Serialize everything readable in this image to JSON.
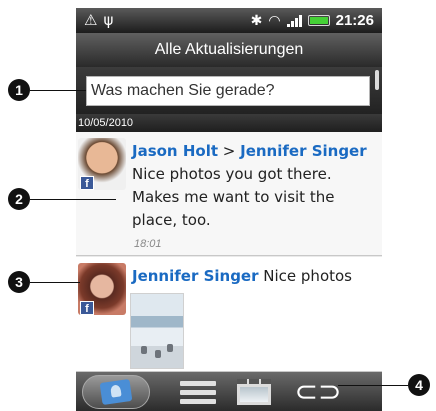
{
  "statusbar": {
    "warning_icon": "warning-icon",
    "usb_icon": "usb-icon",
    "bluetooth_icon": "bluetooth-icon",
    "wifi_icon": "wifi-icon",
    "time": "21:26"
  },
  "title": "Alle Aktualisierungen",
  "input": {
    "placeholder": "Was machen Sie gerade?"
  },
  "date": "10/05/2010",
  "feed": {
    "items": [
      {
        "author": "Jason Holt",
        "separator": " > ",
        "recipient": "Jennifer Singer",
        "message": " Nice photos you got there. Makes me want to visit the place, too.",
        "time": "18:01",
        "network": "f"
      },
      {
        "author": "Jennifer Singer",
        "message": " Nice photos",
        "network": "f"
      }
    ]
  },
  "tabs": [
    {
      "icon": "people-icon",
      "active": true
    },
    {
      "icon": "updates-list-icon",
      "active": false
    },
    {
      "icon": "photos-icon",
      "active": false
    },
    {
      "icon": "link-icon",
      "label": "⊂⊃",
      "active": false
    }
  ],
  "callouts": [
    "1",
    "2",
    "3",
    "4"
  ],
  "colors": {
    "link": "#1a6ac2",
    "facebook": "#3b5998",
    "accent_green": "#45d036"
  }
}
